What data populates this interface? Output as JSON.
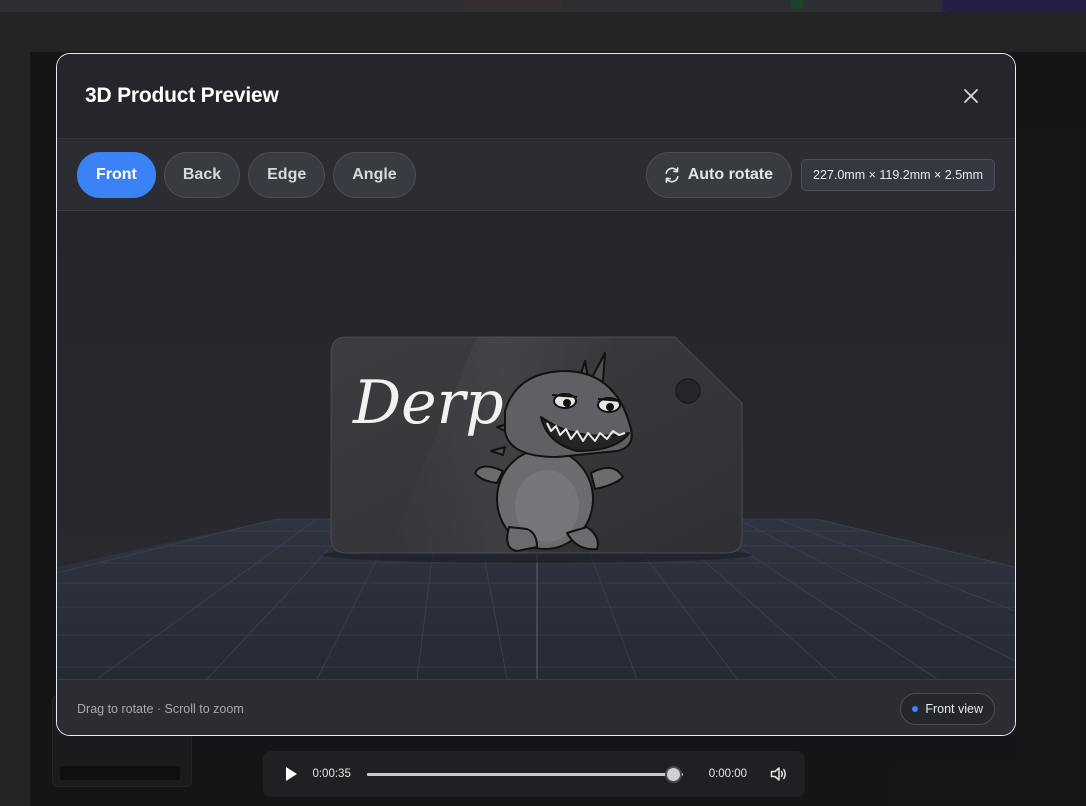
{
  "modal": {
    "title": "3D Product Preview",
    "close_icon": "close-icon"
  },
  "toolbar": {
    "tabs": [
      {
        "label": "Front",
        "active": true
      },
      {
        "label": "Back",
        "active": false
      },
      {
        "label": "Edge",
        "active": false
      },
      {
        "label": "Angle",
        "active": false
      }
    ],
    "auto_rotate_label": "Auto rotate",
    "auto_rotate_icon": "refresh-icon",
    "dimensions": "227.0mm × 119.2mm × 2.5mm"
  },
  "viewport": {
    "tag_text": "Derp",
    "tag_color": "#3a3b3f",
    "grid_color": "#3d4456"
  },
  "footer": {
    "hint": "Drag to rotate · Scroll to zoom",
    "view_label": "Front view",
    "accent_color": "#3b82f6"
  },
  "media": {
    "current_time": "0:00:35",
    "end_time": "0:00:00",
    "progress": 0.97,
    "play_icon": "play-icon",
    "volume_icon": "volume-icon"
  }
}
